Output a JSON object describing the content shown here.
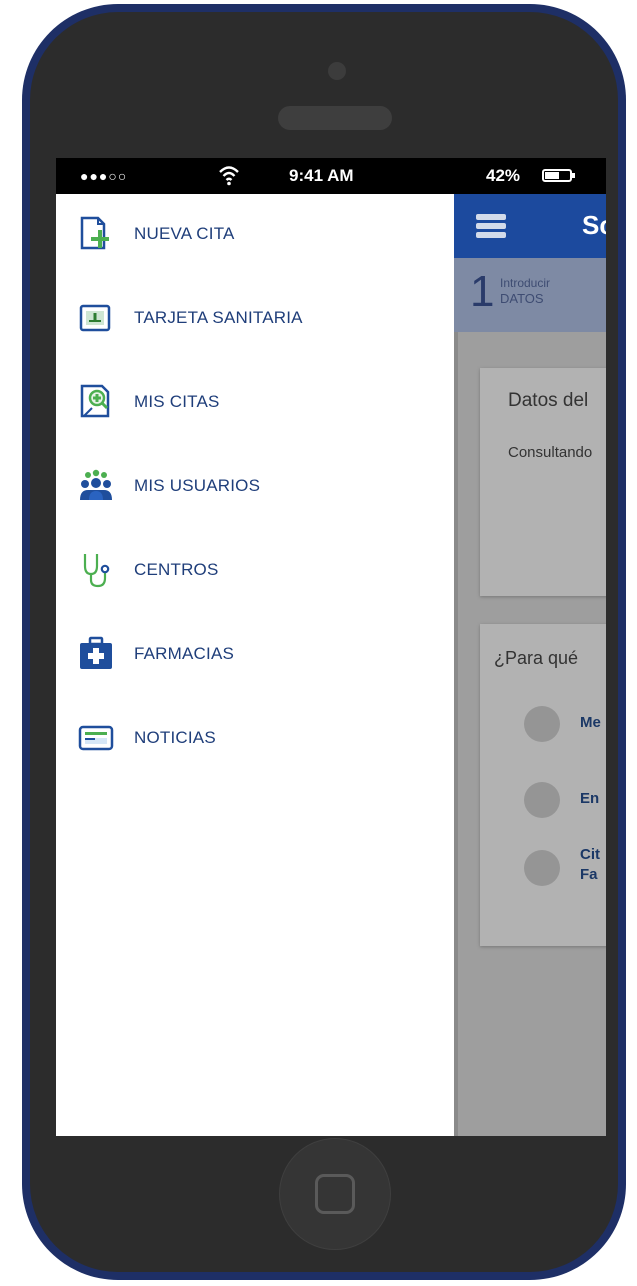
{
  "status_bar": {
    "signal": "●●●○○",
    "time": "9:41 AM",
    "battery_percent": "42%"
  },
  "menu": {
    "items": [
      {
        "label": "NUEVA CITA",
        "icon": "new-appointment-icon"
      },
      {
        "label": "TARJETA SANITARIA",
        "icon": "health-card-icon"
      },
      {
        "label": "MIS CITAS",
        "icon": "my-appointments-icon"
      },
      {
        "label": "MIS USUARIOS",
        "icon": "users-icon"
      },
      {
        "label": "CENTROS",
        "icon": "stethoscope-icon"
      },
      {
        "label": "FARMACIAS",
        "icon": "first-aid-kit-icon"
      },
      {
        "label": "NOTICIAS",
        "icon": "news-icon"
      }
    ]
  },
  "background_app": {
    "header_title": "Sc",
    "step": {
      "number": "1",
      "line1": "Introducir",
      "line2": "DATOS"
    },
    "card1": {
      "title": "Datos del",
      "subtitle": "Consultando"
    },
    "card2": {
      "title": "¿Para qué",
      "options": [
        {
          "line1": "Me",
          "line2": ""
        },
        {
          "line1": "En",
          "line2": ""
        },
        {
          "line1": "Cit",
          "line2": "Fa"
        }
      ]
    }
  },
  "colors": {
    "phone_frame": "#1e2f66",
    "menu_text": "#1f3e7a",
    "header_blue": "#1c4a9e",
    "icon_green": "#4caf50",
    "icon_blue": "#1f4e9c"
  }
}
